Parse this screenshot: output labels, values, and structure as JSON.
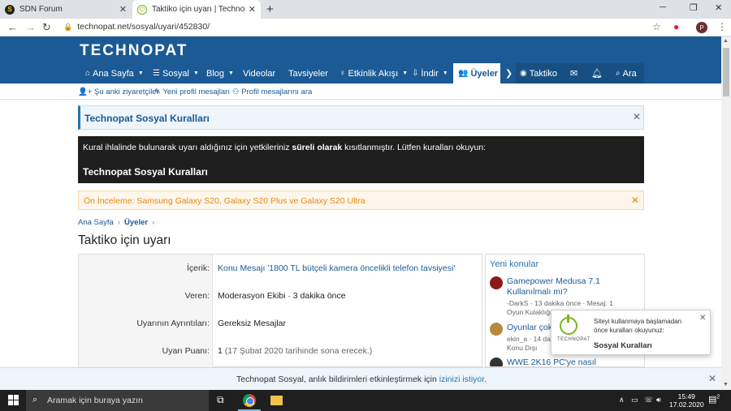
{
  "browser": {
    "tabs": [
      {
        "title": "SDN Forum",
        "active": false
      },
      {
        "title": "Taktiko için uyarı | Technopat Sos",
        "active": true
      }
    ],
    "url": "technopat.net/sosyal/uyari/452830/",
    "profile_initial": "P"
  },
  "site": {
    "logo": "TECHNOPAT",
    "nav": [
      {
        "label": "Ana Sayfa",
        "icon": "home-icon",
        "caret": true
      },
      {
        "label": "Sosyal",
        "icon": "chat-icon",
        "caret": true
      },
      {
        "label": "Blog",
        "icon": "",
        "caret": true
      },
      {
        "label": "Videolar",
        "icon": "",
        "caret": false
      },
      {
        "label": "Tavsiyeler",
        "icon": "",
        "caret": false
      },
      {
        "label": "Etkinlik Akışı",
        "icon": "bulb-icon",
        "caret": true
      },
      {
        "label": "İndir",
        "icon": "download-icon",
        "caret": true
      },
      {
        "label": "Üyeler",
        "icon": "users-icon",
        "caret": false,
        "active": true
      }
    ],
    "user": "Taktiko",
    "search_label": "Ara",
    "subnav": [
      "Şu anki ziyaretçiler",
      "Yeni profil mesajları",
      "Profil mesajlarını ara"
    ]
  },
  "notices": {
    "blue_title": "Technopat Sosyal Kuralları",
    "dark_msg_pre": "Kural ihlalinde bulunarak uyarı aldığınız için yetkileriniz ",
    "dark_msg_bold": "süreli olarak",
    "dark_msg_post": " kısıtlanmıştır. Lütfen kuralları okuyun:",
    "dark_title": "Technopat Sosyal Kuralları",
    "orange": "Ön İnceleme: Samsung Galaxy S20, Galaxy S20 Plus ve Galaxy S20 Ultra"
  },
  "breadcrumb": [
    "Ana Sayfa",
    "Üyeler"
  ],
  "page_title": "Taktiko için uyarı",
  "warning": {
    "rows": [
      {
        "label": "İçerik:",
        "value": "Konu Mesajı '1800 TL bütçeli kamera öncelikli telefon tavsiyesi'",
        "link": true
      },
      {
        "label": "Veren:",
        "value": "Moderasyon Ekibi · 3 dakika önce",
        "link": false
      },
      {
        "label": "Uyarının Ayrıntıları:",
        "value": "Gereksiz Mesajlar",
        "link": false
      },
      {
        "label": "Uyarı Puanı:",
        "value": "1",
        "extra": "(17 Şubat 2020 tarihinde sona erecek.)",
        "link": false
      }
    ]
  },
  "sidebar": {
    "heading": "Yeni konular",
    "items": [
      {
        "title": "Gamepower Medusa 7.1 Kullanılmalı mı?",
        "meta": "-DarkS · 13 dakika önce · Mesaj: 1",
        "forum": "Oyun Kulaklığı",
        "avatar_color": "#8b1a1a"
      },
      {
        "title": "Oyunlar çok",
        "meta": "ekin_a · 14 dakika önce · Mesaj: 3",
        "forum": "Konu Dışı",
        "avatar_color": "#b58a3c"
      },
      {
        "title": "WWE 2K16 PC'ye nasıl indirilebilir?",
        "meta": "",
        "forum": "",
        "avatar_color": "#333333"
      }
    ]
  },
  "popup": {
    "brand": "TECHNOPAT",
    "msg": "Siteyi kullanmaya başlamadan önce kuralları okuyunuz:",
    "link": "Sosyal Kuralları"
  },
  "push_bar": {
    "text": "Technopat Sosyal, anlık bildirimleri etkinleştirmek için ",
    "link": "izinizi istiyor",
    "end": "."
  },
  "taskbar": {
    "search_placeholder": "Aramak için buraya yazın",
    "time": "15:49",
    "date": "17.02.2020",
    "notif_count": "2"
  }
}
